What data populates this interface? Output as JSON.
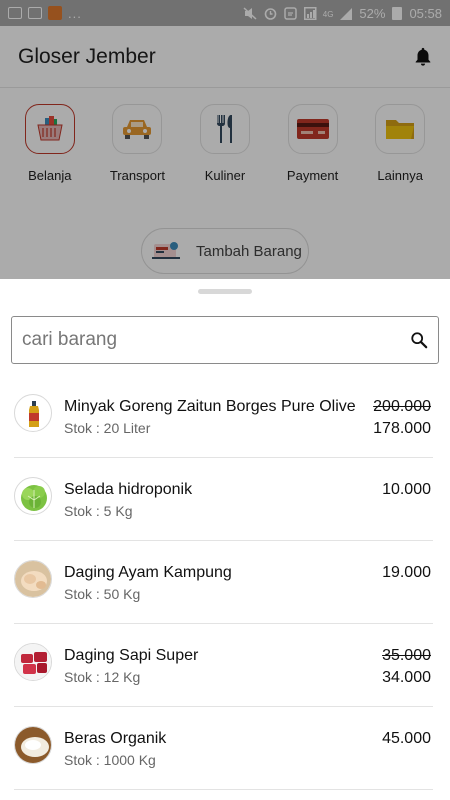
{
  "status_bar": {
    "dots": "...",
    "network": "4G",
    "battery": "52%",
    "time": "05:58"
  },
  "header": {
    "title": "Gloser Jember",
    "icon": "bell-icon"
  },
  "categories": [
    {
      "label": "Belanja",
      "icon": "shopping-basket-icon",
      "color": "#c0392b"
    },
    {
      "label": "Transport",
      "icon": "car-icon",
      "color": "#e69a34"
    },
    {
      "label": "Kuliner",
      "icon": "fork-knife-icon",
      "color": "#34495e"
    },
    {
      "label": "Payment",
      "icon": "credit-card-icon",
      "color": "#c0392b"
    },
    {
      "label": "Lainnya",
      "icon": "folder-icon",
      "color": "#f1c40f"
    }
  ],
  "add_item": {
    "label": "Tambah Barang"
  },
  "search": {
    "placeholder": "cari barang",
    "value": ""
  },
  "products": [
    {
      "name": "Minyak Goreng Zaitun Borges Pure Olive",
      "stock": "Stok : 20 Liter",
      "old_price": "200.000",
      "price": "178.000",
      "icon": "olive-oil-bottle"
    },
    {
      "name": "Selada hidroponik",
      "stock": "Stok : 5 Kg",
      "old_price": "",
      "price": "10.000",
      "icon": "lettuce"
    },
    {
      "name": "Daging Ayam Kampung",
      "stock": "Stok : 50 Kg",
      "old_price": "",
      "price": "19.000",
      "icon": "chicken"
    },
    {
      "name": "Daging Sapi Super",
      "stock": "Stok : 12 Kg",
      "old_price": "35.000",
      "price": "34.000",
      "icon": "beef"
    },
    {
      "name": "Beras Organik",
      "stock": "Stok : 1000 Kg",
      "old_price": "",
      "price": "45.000",
      "icon": "rice"
    }
  ]
}
